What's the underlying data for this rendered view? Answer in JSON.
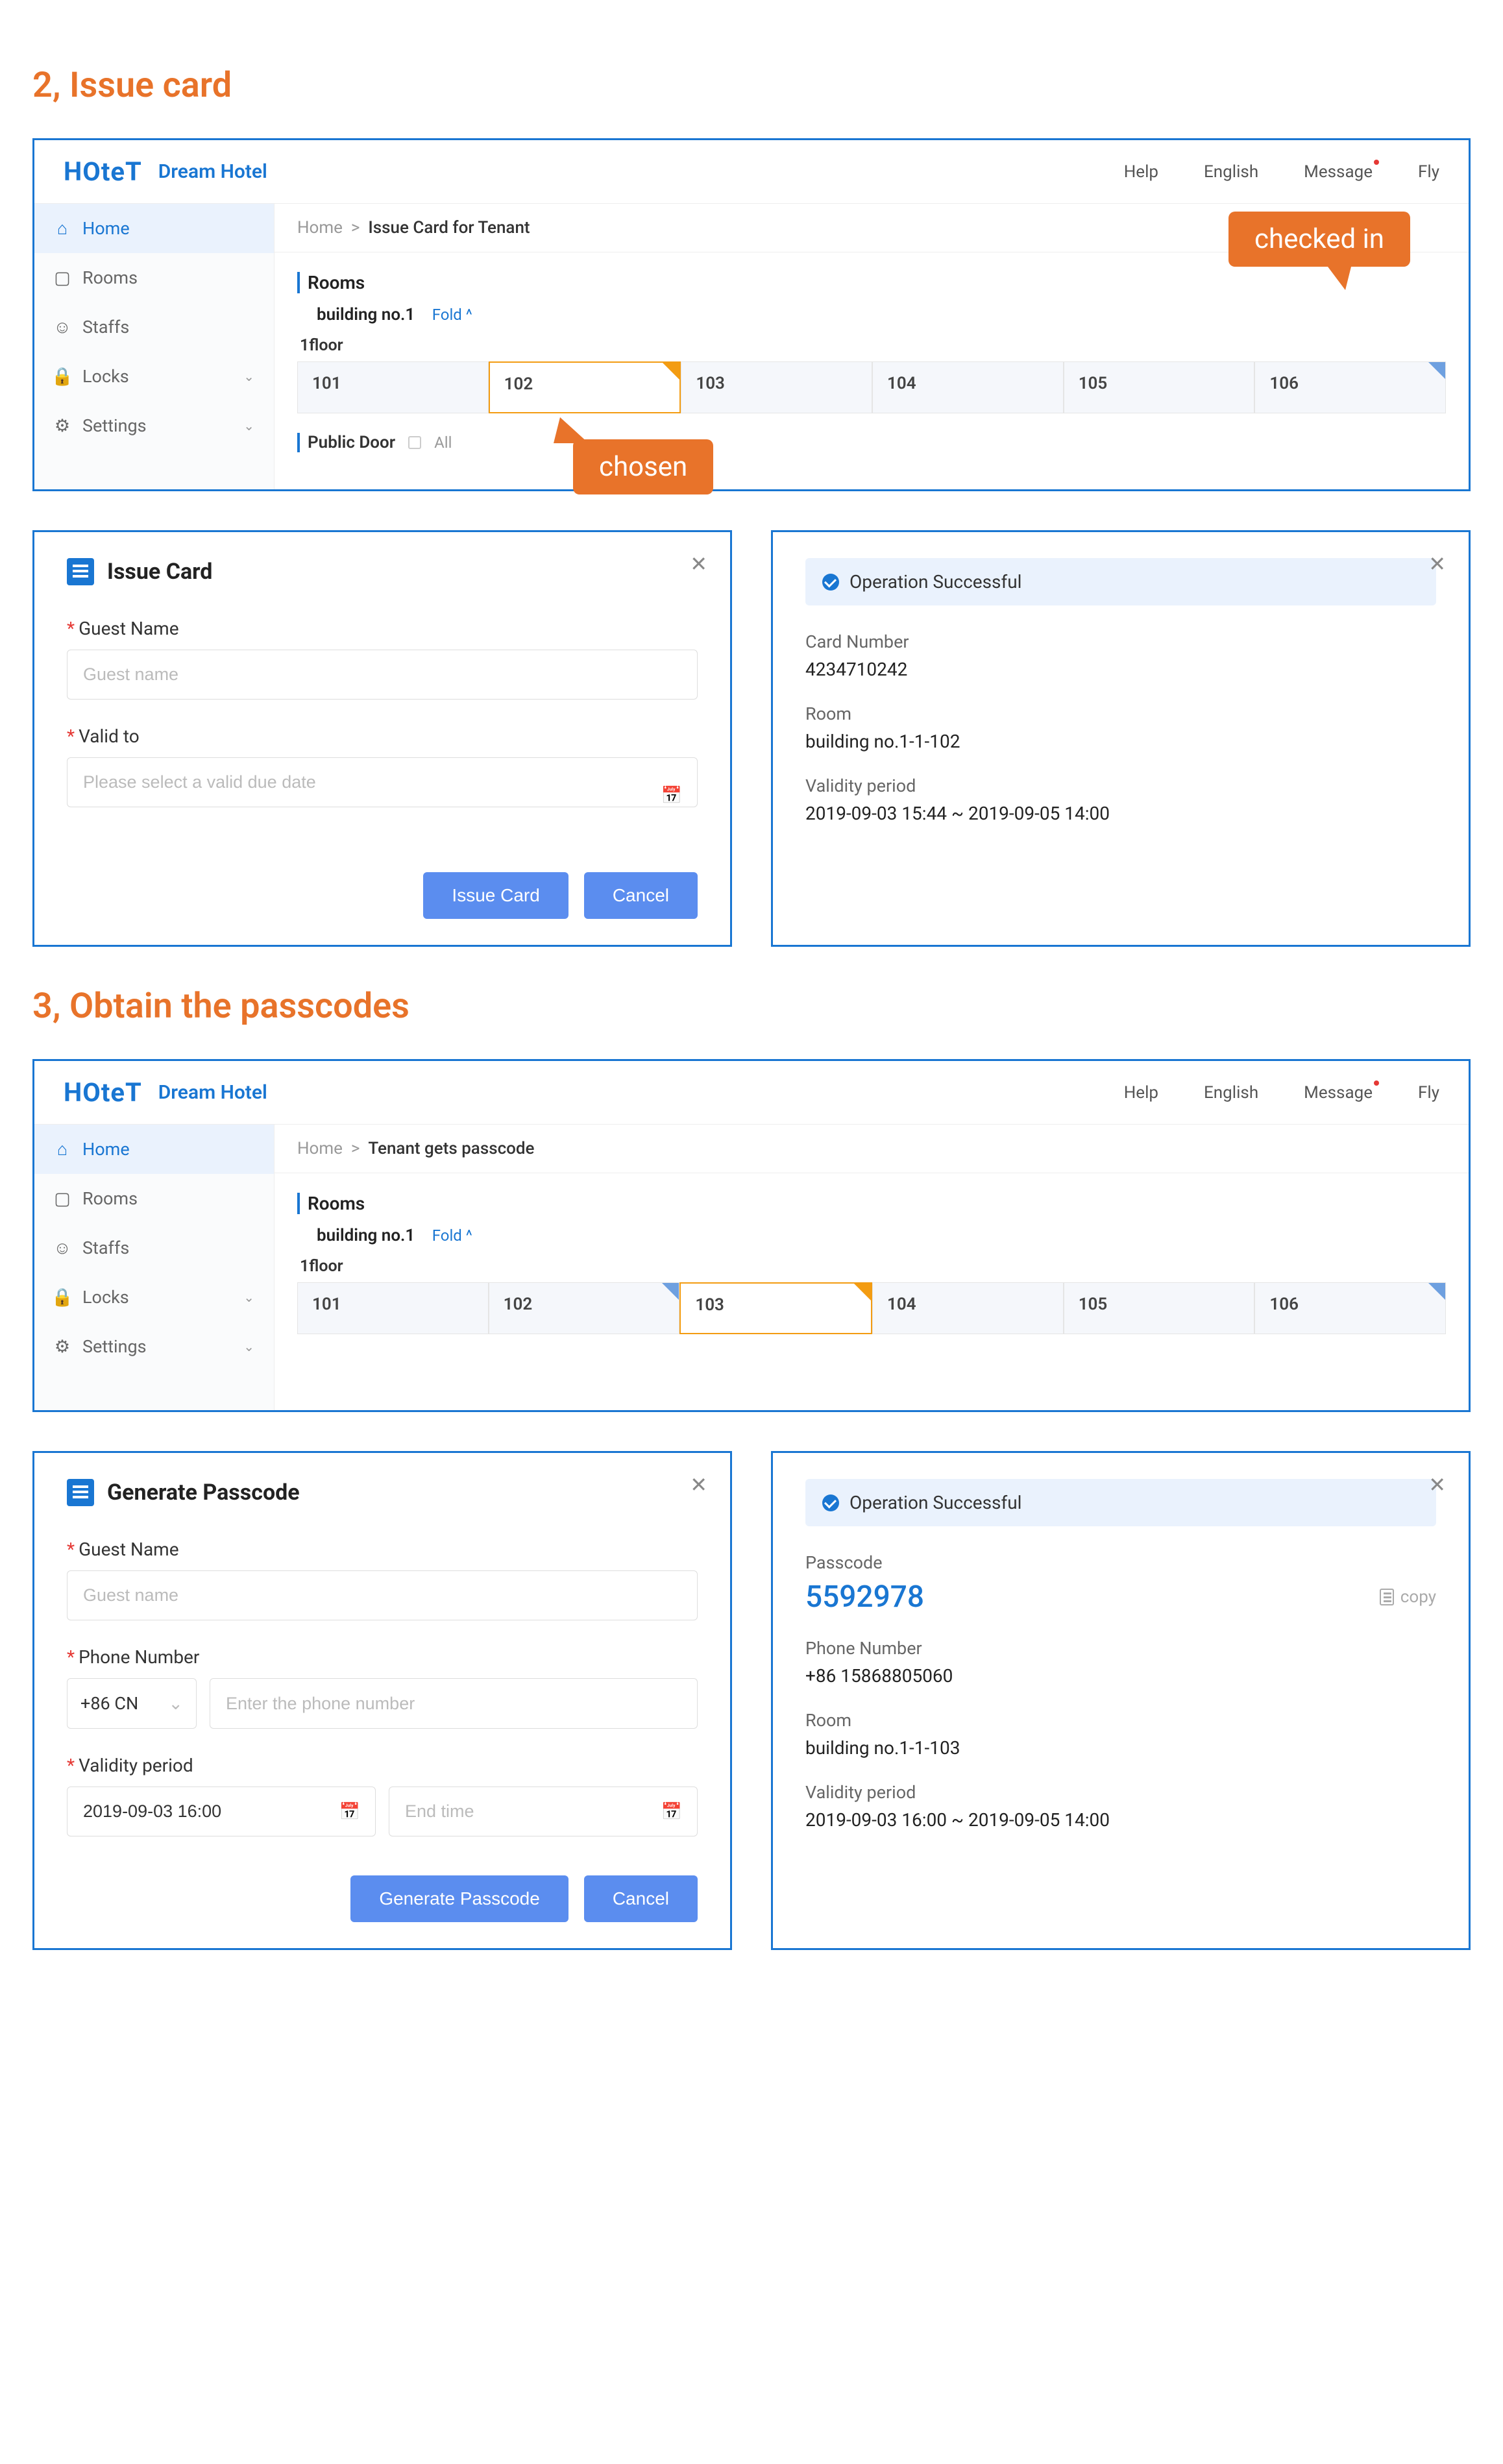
{
  "sections": {
    "s2_title": "2, Issue card",
    "s3_title": "3, Obtain the passcodes"
  },
  "topnav": {
    "logo": "HOteT",
    "brand": "Dream Hotel",
    "help": "Help",
    "lang": "English",
    "message": "Message",
    "user": "Fly"
  },
  "sidebar": {
    "home": "Home",
    "rooms": "Rooms",
    "staffs": "Staffs",
    "locks": "Locks",
    "settings": "Settings"
  },
  "crumbs": {
    "home": "Home",
    "sep": ">",
    "issue": "Issue Card for Tenant",
    "passcode": "Tenant gets passcode"
  },
  "roomsPanel": {
    "header": "Rooms",
    "building": "building no.1",
    "fold": "Fold ^",
    "floor": "1floor",
    "cells": [
      "101",
      "102",
      "103",
      "104",
      "105",
      "106"
    ],
    "publicDoor": "Public Door",
    "all": "All"
  },
  "callouts": {
    "checked": "checked in",
    "chosen": "chosen"
  },
  "issueCard": {
    "title": "Issue Card",
    "guestLabel": "Guest Name",
    "guestPh": "Guest name",
    "validLabel": "Valid to",
    "validPh": "Please select a valid due date",
    "btnIssue": "Issue Card",
    "btnCancel": "Cancel"
  },
  "issueResult": {
    "success": "Operation Successful",
    "cardNumLabel": "Card Number",
    "cardNum": "4234710242",
    "roomLabel": "Room",
    "room": "building no.1-1-102",
    "validLabel": "Validity period",
    "valid": "2019-09-03 15:44  ~  2019-09-05 14:00"
  },
  "genPass": {
    "title": "Generate Passcode",
    "guestLabel": "Guest Name",
    "guestPh": "Guest name",
    "phoneLabel": "Phone Number",
    "cc": "+86 CN",
    "phonePh": "Enter the phone number",
    "validLabel": "Validity period",
    "start": "2019-09-03 16:00",
    "endPh": "End time",
    "btnGen": "Generate Passcode",
    "btnCancel": "Cancel"
  },
  "passResult": {
    "success": "Operation Successful",
    "passLabel": "Passcode",
    "passVal": "5592978",
    "copy": "copy",
    "phoneLabel": "Phone Number",
    "phone": "+86 15868805060",
    "roomLabel": "Room",
    "room": "building no.1-1-103",
    "validLabel": "Validity period",
    "valid": "2019-09-03 16:00  ~  2019-09-05 14:00"
  }
}
